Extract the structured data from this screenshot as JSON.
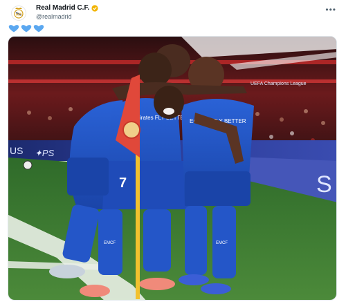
{
  "tweet": {
    "display_name": "Real Madrid C.F.",
    "handle": "@realmadrid",
    "verified_badge_color": "#f2b400",
    "avatar_icon": "real-madrid-crest-icon",
    "more_icon": "more-options-icon",
    "more_label": "•••",
    "text_emoji": [
      "blue-heart-icon",
      "blue-heart-icon",
      "blue-heart-icon"
    ],
    "heart_color": "#5aa7f0"
  },
  "media": {
    "board_text_left": "US",
    "board_text_mid": "UEFA Champions League",
    "board_text_right_top": "UEFA Champions League",
    "board_text_right_s": "S",
    "jersey_number": "7",
    "sponsor_left": "Emirates FLY BETTER",
    "sponsor_right": "Emirates FLY BETTER",
    "sock_text": "EMCF"
  }
}
